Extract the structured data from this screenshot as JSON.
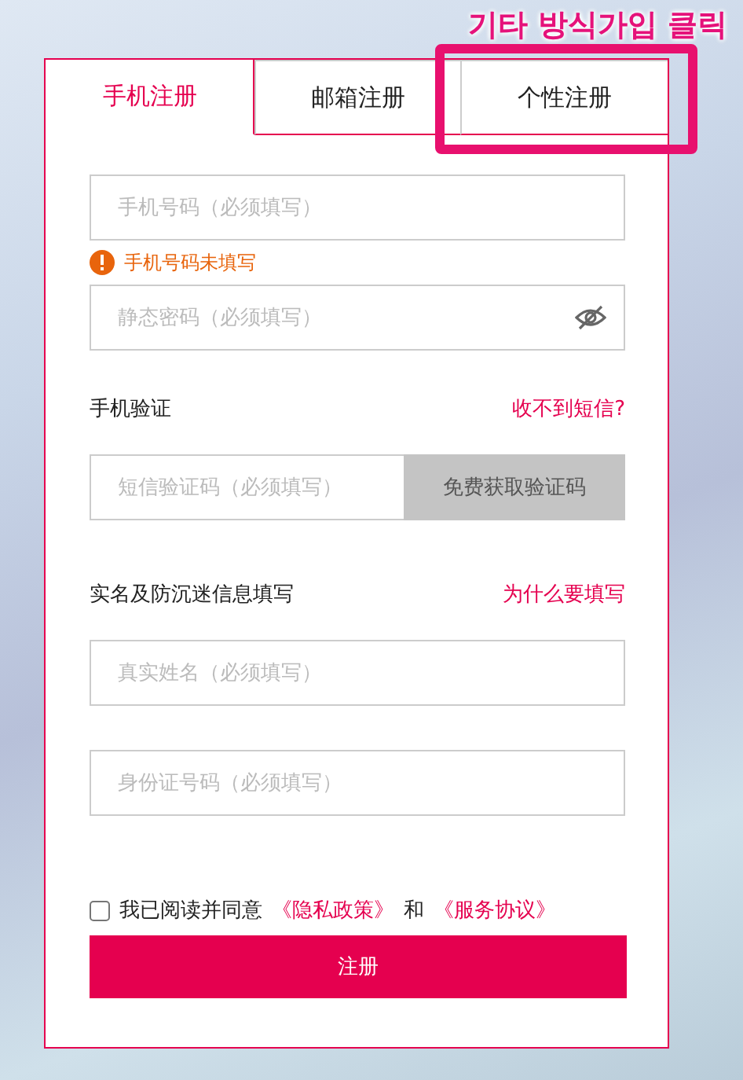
{
  "annotation": {
    "text": "기타 방식가입 클릭"
  },
  "tabs": [
    {
      "label": "手机注册",
      "selected": true
    },
    {
      "label": "邮箱注册",
      "selected": false
    },
    {
      "label": "个性注册",
      "selected": false
    }
  ],
  "phone": {
    "placeholder": "手机号码（必须填写）",
    "error": "手机号码未填写"
  },
  "password": {
    "placeholder": "静态密码（必须填写）"
  },
  "sms_section": {
    "title": "手机验证",
    "link": "收不到短信?"
  },
  "sms": {
    "placeholder": "短信验证码（必须填写）",
    "button": "免费获取验证码",
    "disabled": true
  },
  "realname_section": {
    "title": "实名及防沉迷信息填写",
    "link": "为什么要填写"
  },
  "name": {
    "placeholder": "真实姓名（必须填写）"
  },
  "id_number": {
    "placeholder": "身份证号码（必须填写）"
  },
  "agreement": {
    "checked": false,
    "text": "我已阅读并同意",
    "privacy": "《隐私政策》",
    "and": "和",
    "terms": "《服务协议》"
  },
  "submit": "注册"
}
